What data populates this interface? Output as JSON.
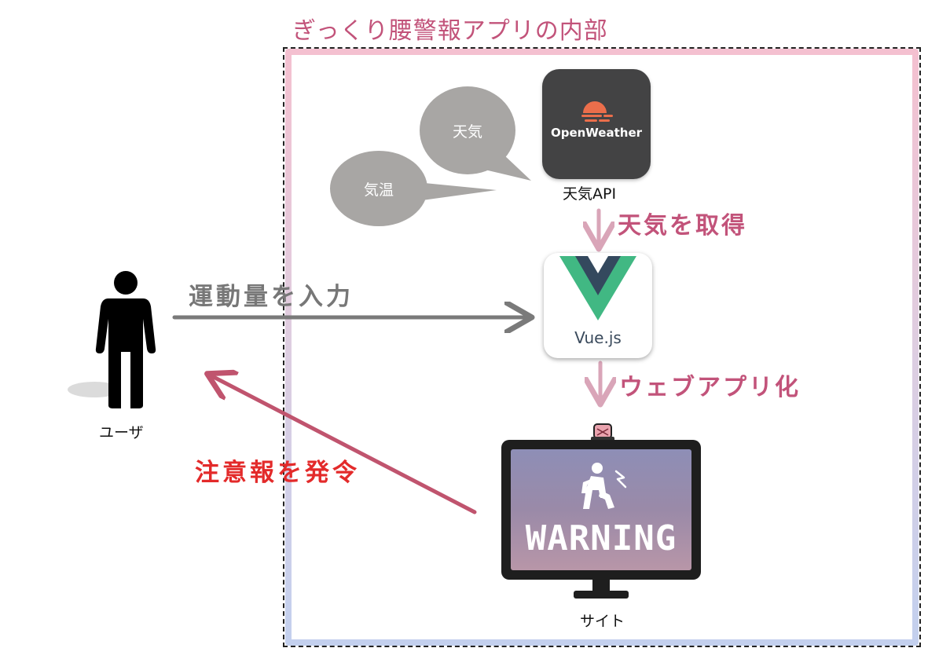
{
  "container": {
    "title": "ぎっくり腰警報アプリの内部"
  },
  "bubbles": {
    "weather": "天気",
    "temperature": "気温"
  },
  "weather_api": {
    "logo_text": "OpenWeather",
    "label": "天気API"
  },
  "steps": {
    "get_weather": "天気を取得",
    "web_app": "ウェブアプリ化"
  },
  "vue": {
    "label": "Vue.js"
  },
  "user": {
    "label": "ユーザ"
  },
  "flows": {
    "input": "運動量を入力",
    "alert": "注意報を発令"
  },
  "site": {
    "screen_text": "WARNING",
    "label": "サイト"
  },
  "colors": {
    "accent_pink": "#c2537a",
    "alert_red": "#e32a2a",
    "arrow_gray": "#7a7a7a",
    "arrow_pink": "#d9a5b8",
    "arrow_crimson": "#c0546e",
    "bubble_gray": "#a8a6a4",
    "vue_green": "#41b883",
    "vue_navy": "#34495e",
    "openweather_orange": "#eb6e4b"
  }
}
